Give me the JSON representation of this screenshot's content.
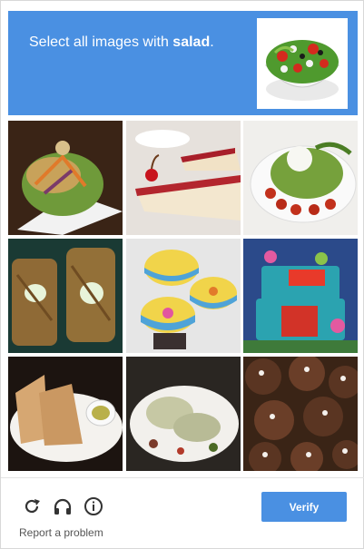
{
  "header": {
    "instruction_prefix": "Select all images with ",
    "keyword": "salad",
    "instruction_suffix": "."
  },
  "sample_image": {
    "depicts": "salad bowl"
  },
  "tiles": [
    {
      "depicts": "salad-plate"
    },
    {
      "depicts": "cheesecake-slice"
    },
    {
      "depicts": "caprese-salad"
    },
    {
      "depicts": "tuna-sandwich"
    },
    {
      "depicts": "cupcakes"
    },
    {
      "depicts": "birthday-cake"
    },
    {
      "depicts": "bread-and-oil"
    },
    {
      "depicts": "fish-dish"
    },
    {
      "depicts": "cookies"
    }
  ],
  "footer": {
    "reload_icon": "reload-icon",
    "audio_icon": "headphones-icon",
    "info_icon": "info-icon",
    "report_label": "Report a problem",
    "verify_label": "Verify"
  },
  "colors": {
    "accent": "#4a90e2"
  }
}
